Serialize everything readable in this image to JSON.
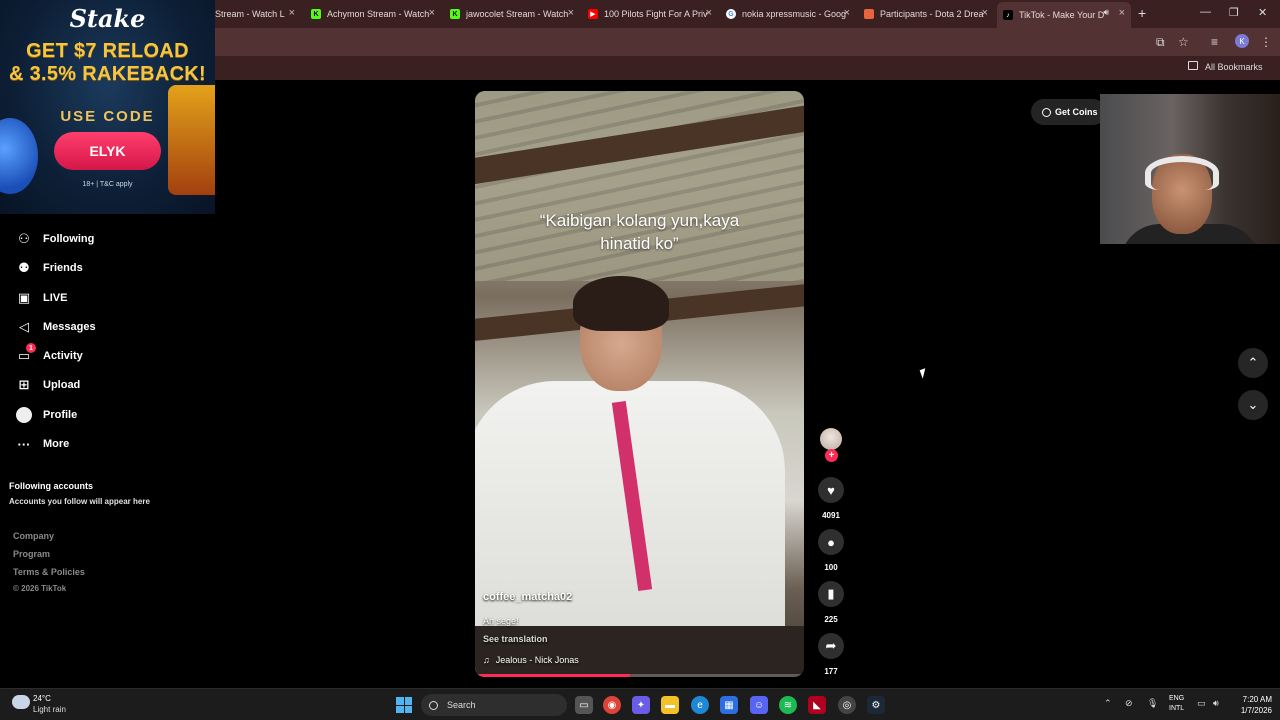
{
  "browser": {
    "tabs": [
      {
        "title": "Stream - Watch L",
        "favicon": "kick-icon",
        "color": "#53fc18"
      },
      {
        "title": "Achymon Stream - Watch",
        "favicon": "kick-icon",
        "color": "#53fc18"
      },
      {
        "title": "jawocolet Stream - Watch",
        "favicon": "kick-icon",
        "color": "#53fc18"
      },
      {
        "title": "100 Pilots Fight For A Priv",
        "favicon": "youtube-icon",
        "color": "#ff0000"
      },
      {
        "title": "nokia xpressmusic - Goog",
        "favicon": "google-icon",
        "color": "#ffffff"
      },
      {
        "title": "Participants - Dota 2 Drea",
        "favicon": "liquipedia-icon",
        "color": "#e8643c"
      },
      {
        "title": "TikTok - Make Your D",
        "favicon": "tiktok-icon",
        "color": "#ffffff"
      }
    ],
    "new_tab": "+",
    "profile_initial": "K",
    "bookmarks_label": "All Bookmarks"
  },
  "ad": {
    "brand": "Stake",
    "headline_1": "GET $7 RELOAD",
    "headline_2": "& 3.5% RAKEBACK!",
    "use_code": "USE CODE",
    "code": "ELYK",
    "disclaimer": "18+ | T&C apply"
  },
  "sidebar": {
    "items": [
      {
        "label": "Following",
        "icon": "following-icon"
      },
      {
        "label": "Friends",
        "icon": "friends-icon"
      },
      {
        "label": "LIVE",
        "icon": "live-icon"
      },
      {
        "label": "Messages",
        "icon": "messages-icon"
      },
      {
        "label": "Activity",
        "icon": "activity-icon",
        "badge": "1"
      },
      {
        "label": "Upload",
        "icon": "upload-icon"
      },
      {
        "label": "Profile",
        "icon": "profile-avatar"
      },
      {
        "label": "More",
        "icon": "more-icon"
      }
    ],
    "following_title": "Following accounts",
    "following_sub": "Accounts you follow will appear here",
    "links": [
      "Company",
      "Program",
      "Terms & Policies"
    ],
    "copyright": "© 2026 TikTok"
  },
  "video": {
    "caption_line_1": "“Kaibigan kolang yun,kaya",
    "caption_line_2": "hinatid ko”",
    "username": "coffee_matcha02",
    "description": "Ah sege!",
    "see_translation": "See translation",
    "music": "Jealous - Nick Jonas",
    "progress": 0.47
  },
  "actions": {
    "likes": "4091",
    "comments": "100",
    "saves": "225",
    "shares": "177"
  },
  "get_coins": "Get Coins",
  "taskbar": {
    "weather_temp": "24°C",
    "weather_desc": "Light rain",
    "search_placeholder": "Search",
    "lang_1": "ENG",
    "lang_2": "INTL",
    "time": "7:20 AM",
    "date": "1/7/2026"
  }
}
